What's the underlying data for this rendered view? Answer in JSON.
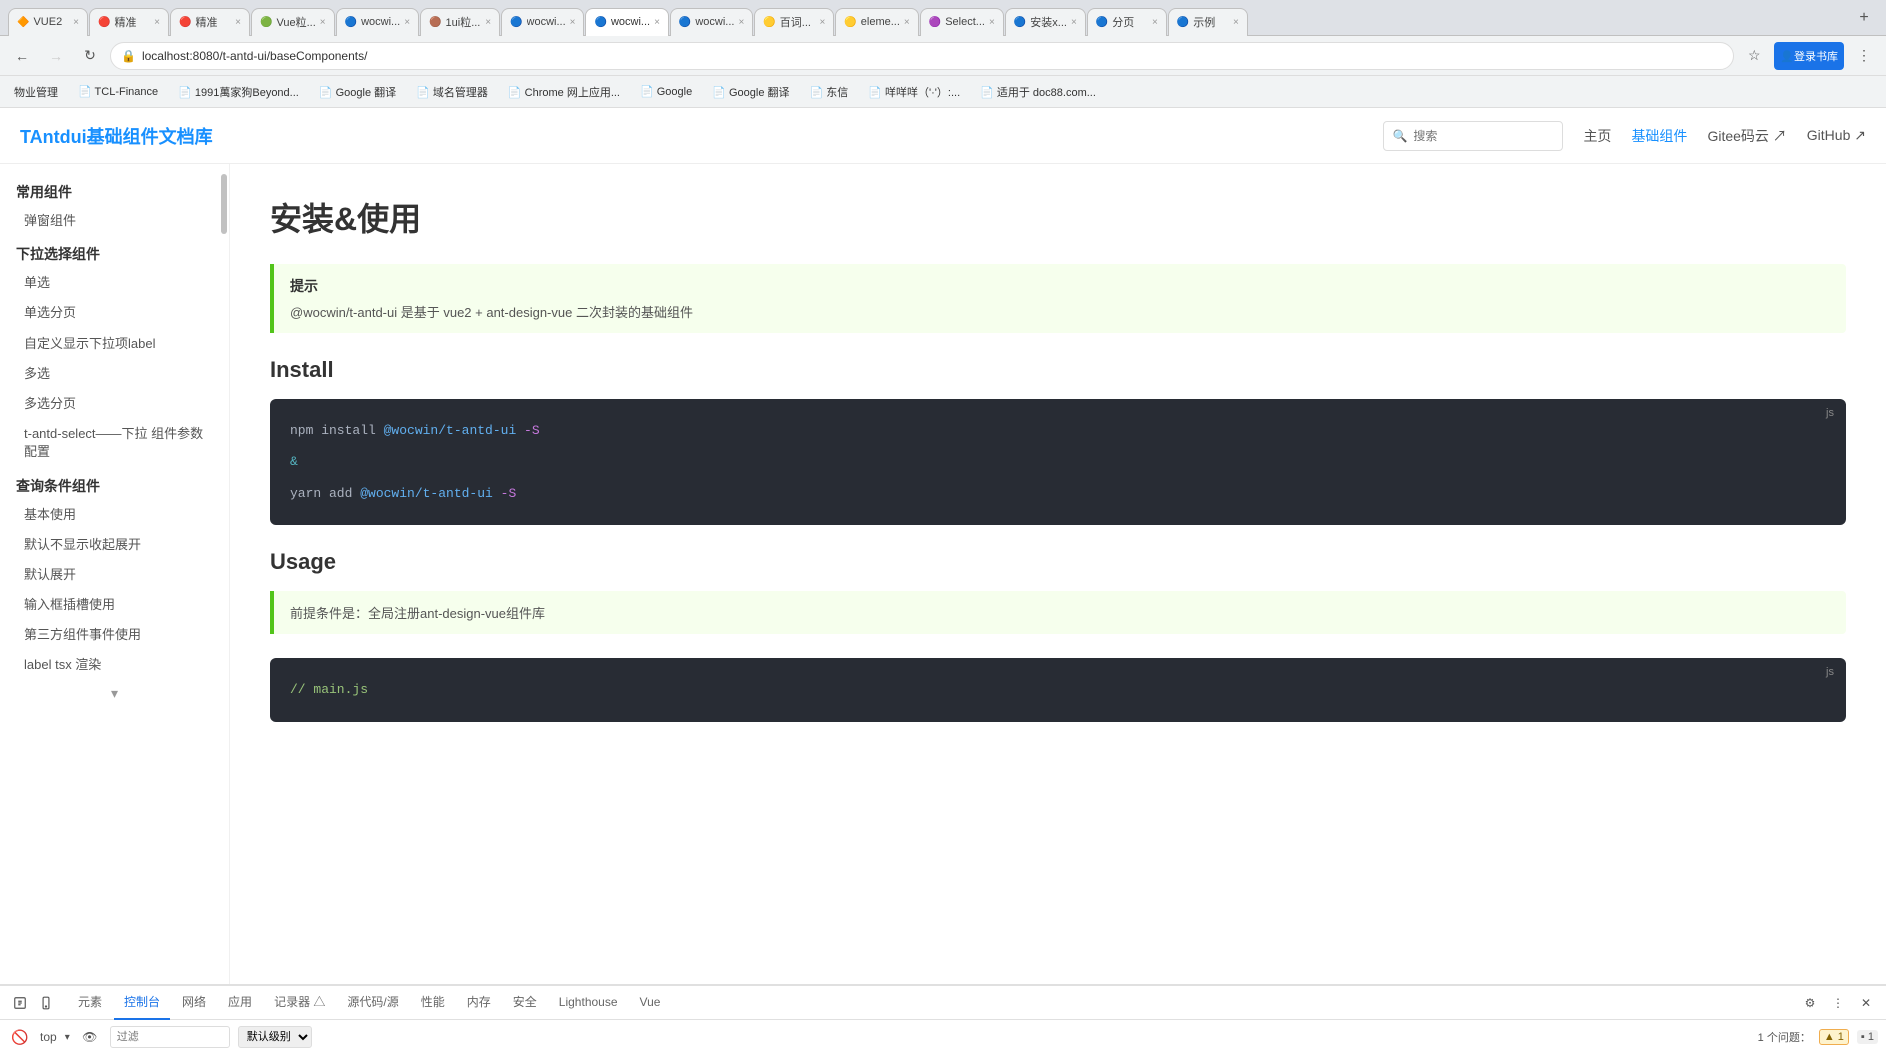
{
  "browser": {
    "tabs": [
      {
        "id": 1,
        "label": "VUE2",
        "active": false,
        "favicon": "🔶"
      },
      {
        "id": 2,
        "label": "精准",
        "active": false,
        "favicon": "🔴"
      },
      {
        "id": 3,
        "label": "精准",
        "active": false,
        "favicon": "🔴"
      },
      {
        "id": 4,
        "label": "Vue粒...",
        "active": false,
        "favicon": "🟢"
      },
      {
        "id": 5,
        "label": "wocwi...",
        "active": false,
        "favicon": "🔵"
      },
      {
        "id": 6,
        "label": "1ui粒...",
        "active": false,
        "favicon": "🟤"
      },
      {
        "id": 7,
        "label": "wocwi...",
        "active": false,
        "favicon": "🔵"
      },
      {
        "id": 8,
        "label": "wocwi...",
        "active": true,
        "favicon": "🔵"
      },
      {
        "id": 9,
        "label": "wocwi...",
        "active": false,
        "favicon": "🔵"
      },
      {
        "id": 10,
        "label": "百词...",
        "active": false,
        "favicon": "🟡"
      },
      {
        "id": 11,
        "label": "eleme...",
        "active": false,
        "favicon": "🟡"
      },
      {
        "id": 12,
        "label": "Select...",
        "active": false,
        "favicon": "🟣"
      },
      {
        "id": 13,
        "label": "安装x...",
        "active": false,
        "favicon": "🔵"
      },
      {
        "id": 14,
        "label": "分页",
        "active": false,
        "favicon": "🔵"
      },
      {
        "id": 15,
        "label": "示例",
        "active": false,
        "favicon": "🔵"
      }
    ],
    "address": "localhost:8080/t-antd-ui/baseComponents/",
    "bookmarks": [
      {
        "label": "物业管理"
      },
      {
        "label": "TCL-Finance"
      },
      {
        "label": "1991萬家狗Beyond..."
      },
      {
        "label": "Google 翻译"
      },
      {
        "label": "域名管理器"
      },
      {
        "label": "Chrome 网上应用..."
      },
      {
        "label": "Google"
      },
      {
        "label": "Google 翻译"
      },
      {
        "label": "东信"
      },
      {
        "label": "咩咩咩（'·'）:..."
      },
      {
        "label": "适用于 doc88.com..."
      }
    ]
  },
  "site": {
    "logo": "TAntdui基础组件文档库",
    "search_placeholder": "搜索",
    "nav_items": [
      {
        "label": "主页",
        "active": false
      },
      {
        "label": "基础组件",
        "active": true
      },
      {
        "label": "Gitee码云 ↗",
        "active": false
      },
      {
        "label": "GitHub ↗",
        "active": false
      }
    ]
  },
  "sidebar": {
    "sections": [
      {
        "title": "常用组件",
        "items": [
          "弹窗组件"
        ]
      },
      {
        "title": "下拉选择组件",
        "items": [
          "单选",
          "单选分页",
          "自定义显示下拉项label",
          "多选",
          "多选分页",
          "t-antd-select——下拉 组件参数配置"
        ]
      },
      {
        "title": "查询条件组件",
        "items": [
          "基本使用",
          "默认不显示收起展开",
          "默认展开",
          "输入框插槽使用",
          "第三方组件事件使用",
          "label tsx 渲染"
        ]
      }
    ]
  },
  "main": {
    "page_title": "安装&使用",
    "hint": {
      "title": "提示",
      "text": "@wocwin/t-antd-ui 是基于 vue2 + ant-design-vue 二次封装的基础组件"
    },
    "install_section": {
      "title": "Install",
      "code_lang": "js",
      "lines": [
        {
          "text": "npm install @wocwin/t-antd-ui -S",
          "type": "command"
        },
        {
          "text": "&",
          "type": "amp"
        },
        {
          "text": "yarn add @wocwin/t-antd-ui -S",
          "type": "command"
        }
      ]
    },
    "usage_section": {
      "title": "Usage",
      "hint_text": "前提条件是：全局注册ant-design-vue组件库",
      "code_lang": "js",
      "code_comment": "// main.js"
    }
  },
  "devtools": {
    "tabs": [
      {
        "label": "☰",
        "active": false
      },
      {
        "label": "元素",
        "active": false
      },
      {
        "label": "控制台",
        "active": true
      },
      {
        "label": "网络",
        "active": false
      },
      {
        "label": "应用",
        "active": false
      },
      {
        "label": "记录器 △",
        "active": false
      },
      {
        "label": "源代码/源",
        "active": false
      },
      {
        "label": "性能",
        "active": false
      },
      {
        "label": "内存",
        "active": false
      },
      {
        "label": "安全",
        "active": false
      },
      {
        "label": "Lighthouse",
        "active": false
      },
      {
        "label": "Vue",
        "active": false
      }
    ],
    "toolbar": {
      "block_icon": "🚫",
      "level_label": "top",
      "eye_icon": "👁",
      "filter_placeholder": "过滤",
      "level_select": "默认级别",
      "issue_count": "1 个问题：",
      "issue_badge": "▲ 1"
    }
  }
}
